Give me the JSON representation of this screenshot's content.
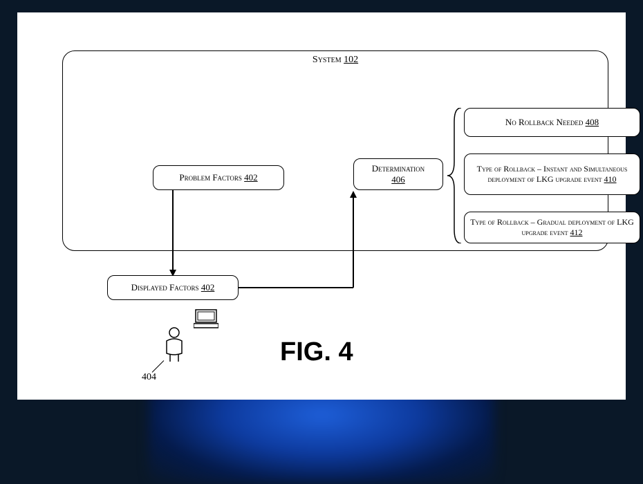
{
  "figure_label": "FIG. 4",
  "system": {
    "title_text": "System",
    "title_ref": "102"
  },
  "nodes": {
    "problem_factors": {
      "label": "Problem Factors",
      "ref": "402"
    },
    "determination": {
      "label": "Determination",
      "ref": "406"
    },
    "no_rollback": {
      "label": "No Rollback Needed",
      "ref": "408"
    },
    "type_instant": {
      "label": "Type of Rollback – Instant and Simultaneous deployment of LKG upgrade event",
      "ref": "410"
    },
    "type_gradual": {
      "label": "Type of Rollback – Gradual deployment of LKG upgrade event",
      "ref": "412"
    },
    "displayed_factors": {
      "label": "Displayed Factors",
      "ref": "402"
    }
  },
  "user_ref": "404"
}
